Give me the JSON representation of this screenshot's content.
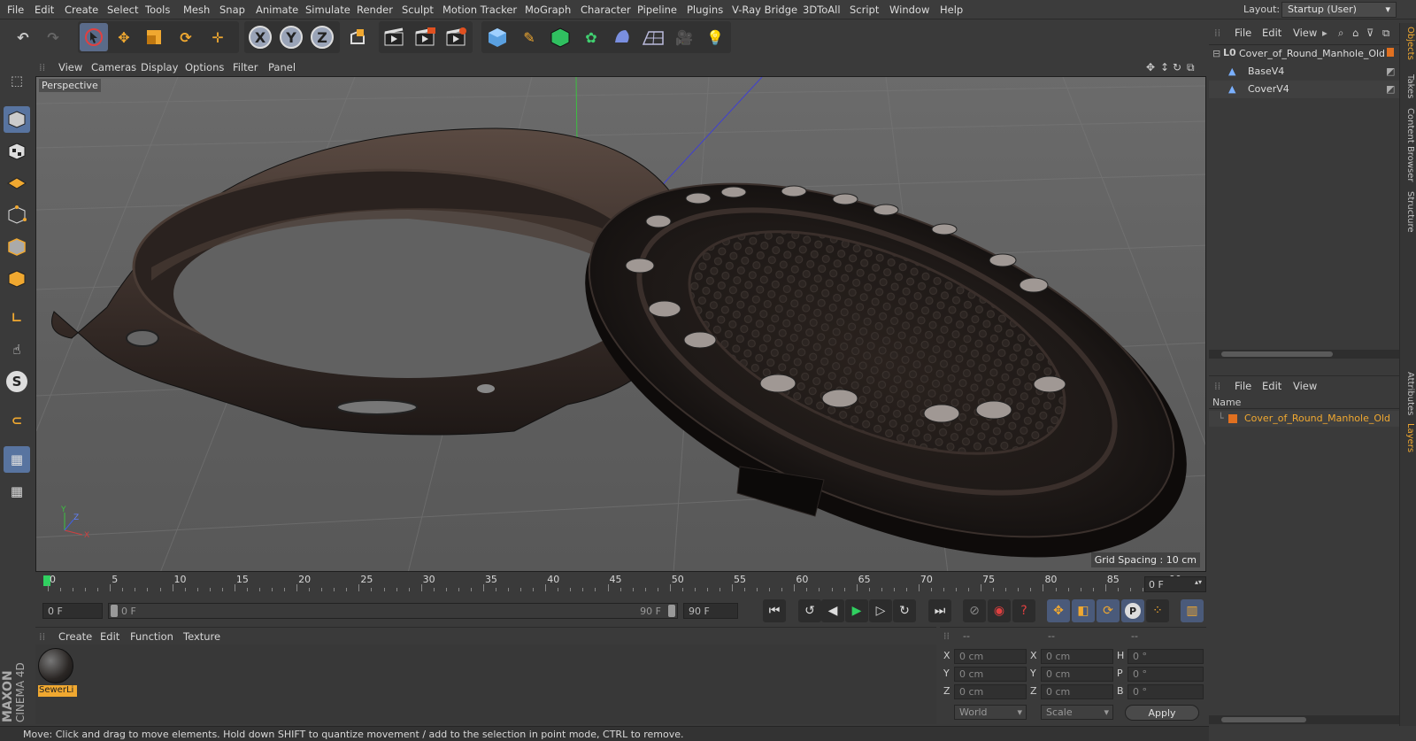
{
  "menubar": {
    "items": [
      "File",
      "Edit",
      "Create",
      "Select",
      "Tools",
      "Mesh",
      "Snap",
      "Animate",
      "Simulate",
      "Render",
      "Sculpt",
      "Motion Tracker",
      "MoGraph",
      "Character",
      "Pipeline",
      "Plugins",
      "V-Ray Bridge",
      "3DToAll",
      "Script",
      "Window",
      "Help"
    ],
    "layout_label": "Layout:",
    "layout_value": "Startup (User)"
  },
  "toolbar": {
    "axis_x": "X",
    "axis_y": "Y",
    "axis_z": "Z",
    "icons": [
      "undo-icon",
      "redo-icon",
      "live-selection-icon",
      "move-icon",
      "scale-icon",
      "rotate-icon",
      "recent-tool-icon",
      "x-axis-icon",
      "y-axis-icon",
      "z-axis-icon",
      "coordinate-system-icon",
      "render-view-icon",
      "render-picture-viewer-icon",
      "render-settings-icon",
      "cube-icon",
      "pen-icon",
      "subdivision-icon",
      "cloner-icon",
      "deformer-icon",
      "floor-icon",
      "camera-icon",
      "light-icon"
    ]
  },
  "viewport": {
    "menu": [
      "View",
      "Cameras",
      "Display",
      "Options",
      "Filter",
      "Panel"
    ],
    "label": "Perspective",
    "grid_spacing": "Grid Spacing : 10 cm"
  },
  "timeline": {
    "ticks": [
      "0",
      "5",
      "10",
      "15",
      "20",
      "25",
      "30",
      "35",
      "40",
      "45",
      "50",
      "55",
      "60",
      "65",
      "70",
      "75",
      "80",
      "85",
      "90"
    ],
    "current_frame": "0 F"
  },
  "transport": {
    "start_field": "0 F",
    "range_start": "0 F",
    "range_end": "90 F",
    "end_field": "90 F"
  },
  "material_manager": {
    "menu": [
      "Create",
      "Edit",
      "Function",
      "Texture"
    ],
    "material_name": "SewerLi"
  },
  "coordinates": {
    "header_cols": [
      "--",
      "--",
      "--"
    ],
    "rows": [
      {
        "label1": "X",
        "val1": "0 cm",
        "label2": "X",
        "val2": "0 cm",
        "label3": "H",
        "val3": "0 °"
      },
      {
        "label1": "Y",
        "val1": "0 cm",
        "label2": "Y",
        "val2": "0 cm",
        "label3": "P",
        "val3": "0 °"
      },
      {
        "label1": "Z",
        "val1": "0 cm",
        "label2": "Z",
        "val2": "0 cm",
        "label3": "B",
        "val3": "0 °"
      }
    ],
    "mode_world": "World",
    "mode_scale": "Scale",
    "apply": "Apply"
  },
  "status": "Move: Click and drag to move elements. Hold down SHIFT to quantize movement / add to the selection in point mode, CTRL to remove.",
  "objects": {
    "menu": [
      "File",
      "Edit",
      "View"
    ],
    "items": [
      {
        "name": "Cover_of_Round_Manhole_Old",
        "level": 0
      },
      {
        "name": "BaseV4",
        "level": 1
      },
      {
        "name": "CoverV4",
        "level": 1
      }
    ]
  },
  "layers": {
    "menu": [
      "File",
      "Edit",
      "View"
    ],
    "column": "Name",
    "items": [
      "Cover_of_Round_Manhole_Old"
    ]
  },
  "side_tabs": [
    "Objects",
    "Takes",
    "Content Browser",
    "Structure",
    "Attributes",
    "Layers"
  ],
  "brand": {
    "line1": "MAXON",
    "line2": "CINEMA 4D"
  },
  "colors": {
    "accent": "#f0a830",
    "selection": "#5874a0",
    "layer_orange": "#e07020"
  }
}
